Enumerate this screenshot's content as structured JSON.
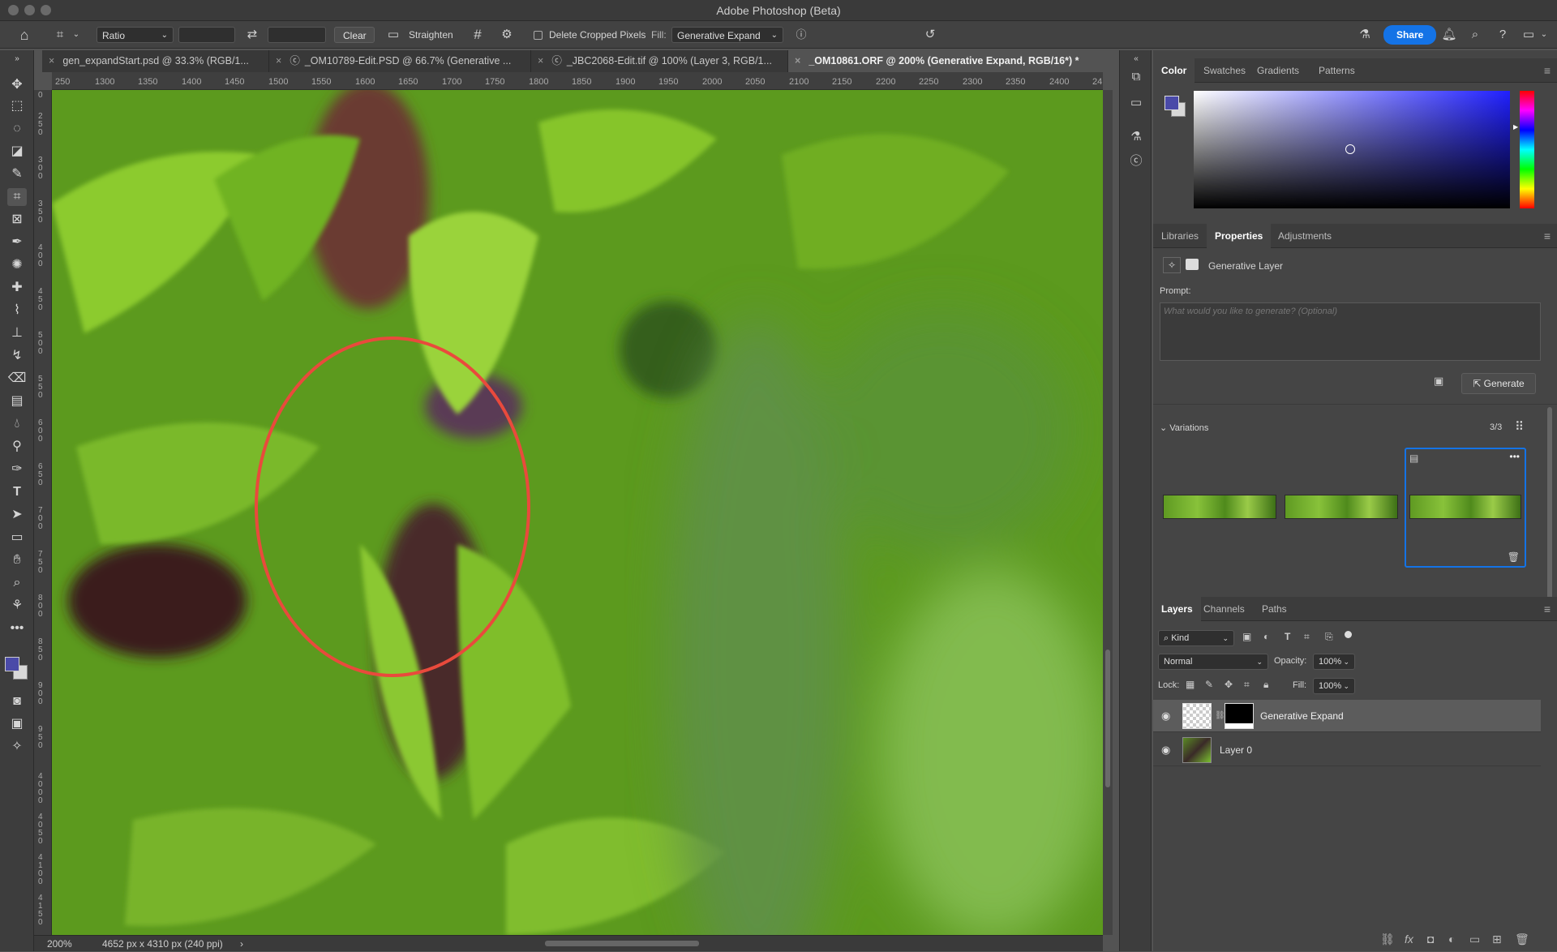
{
  "window": {
    "title": "Adobe Photoshop (Beta)"
  },
  "options": {
    "ratio_label": "Ratio",
    "clear_label": "Clear",
    "straighten_label": "Straighten",
    "delete_cropped_label": "Delete Cropped Pixels",
    "fill_label": "Fill:",
    "fill_value": "Generative Expand",
    "share_label": "Share"
  },
  "tabs": [
    {
      "label": "gen_expandStart.psd @ 33.3% (RGB/1...",
      "active": false
    },
    {
      "label": "_OM10789-Edit.PSD @ 66.7% (Generative ...",
      "active": false
    },
    {
      "label": "_JBC2068-Edit.tif @ 100% (Layer 3, RGB/1...",
      "active": false
    },
    {
      "label": "_OM10861.ORF @ 200% (Generative Expand, RGB/16*) *",
      "active": true
    }
  ],
  "ruler_top": [
    "250",
    "1300",
    "1350",
    "1400",
    "1450",
    "1500",
    "1550",
    "1600",
    "1650",
    "1700",
    "1750",
    "1800",
    "1850",
    "1900",
    "1950",
    "2000",
    "2050",
    "2100",
    "2150",
    "2200",
    "2250",
    "2300",
    "2350",
    "2400",
    "24"
  ],
  "ruler_left": [
    "0",
    "250",
    "300",
    "350",
    "400",
    "450",
    "500",
    "550",
    "600",
    "650",
    "700",
    "750",
    "800",
    "850",
    "900",
    "950",
    "4000",
    "4050",
    "4100",
    "4150"
  ],
  "status": {
    "zoom": "200%",
    "doc_size": "4652 px x 4310 px (240 ppi)"
  },
  "color_panel": {
    "tabs": [
      "Color",
      "Swatches",
      "Gradients",
      "Patterns"
    ],
    "fg_color": "#4a4aa8"
  },
  "properties_panel": {
    "tabs": [
      "Libraries",
      "Properties",
      "Adjustments"
    ],
    "layer_type": "Generative Layer",
    "prompt_label": "Prompt:",
    "prompt_placeholder": "What would you like to generate? (Optional)",
    "generate_label": "Generate",
    "variations_label": "Variations",
    "variations_count": "3/3"
  },
  "layers_panel": {
    "tabs": [
      "Layers",
      "Channels",
      "Paths"
    ],
    "filter_kind": "Kind",
    "blend_mode": "Normal",
    "opacity_label": "Opacity:",
    "opacity_value": "100%",
    "lock_label": "Lock:",
    "fill_label": "Fill:",
    "fill_value": "100%",
    "layers": [
      {
        "name": "Generative Expand",
        "selected": true
      },
      {
        "name": "Layer 0",
        "selected": false
      }
    ]
  }
}
